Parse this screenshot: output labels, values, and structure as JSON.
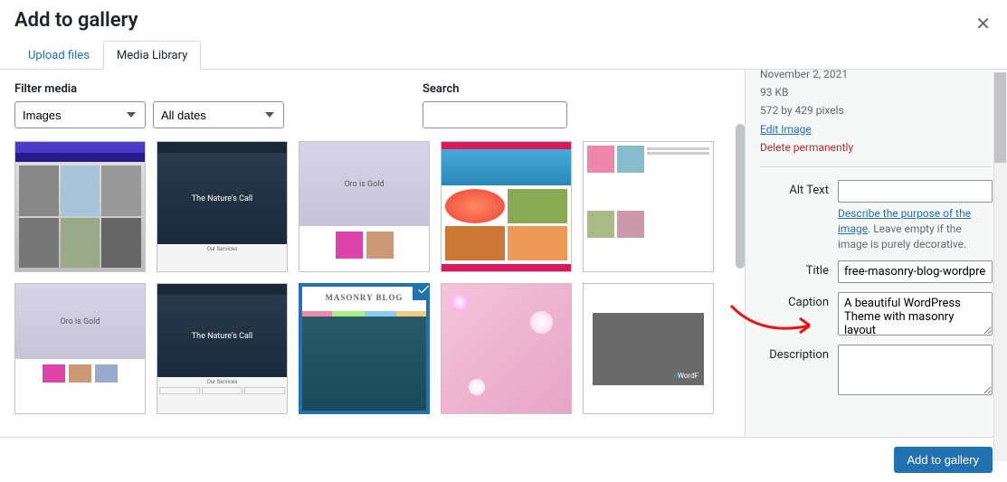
{
  "header": {
    "title": "Add to gallery"
  },
  "tabs": [
    {
      "label": "Upload files",
      "active": false
    },
    {
      "label": "Media Library",
      "active": true
    }
  ],
  "toolbar": {
    "filter_label": "Filter media",
    "type_select": "Images",
    "date_select": "All dates",
    "search_label": "Search",
    "search_value": ""
  },
  "grid": {
    "items": [
      {
        "selected": false,
        "label": "Magazine theme thumbnail"
      },
      {
        "selected": false,
        "label": "Nature's Call dark theme"
      },
      {
        "selected": false,
        "label": "Oro is Gold light theme"
      },
      {
        "selected": false,
        "label": "Food magazine grid theme"
      },
      {
        "selected": false,
        "label": "News list layout theme"
      },
      {
        "selected": false,
        "label": "Oro is Gold variant theme"
      },
      {
        "selected": false,
        "label": "Nature's Call services theme"
      },
      {
        "selected": true,
        "label": "Masonry Blog theme"
      },
      {
        "selected": false,
        "label": "Pink flowers photo"
      },
      {
        "selected": false,
        "label": "eWordPress placeholder"
      }
    ]
  },
  "details": {
    "date": "November 2, 2021",
    "filesize": "93 KB",
    "dimensions": "572 by 429 pixels",
    "edit_link": "Edit Image",
    "delete_link": "Delete permanently",
    "alt_label": "Alt Text",
    "alt_value": "",
    "alt_help_link": "Describe the purpose of the image",
    "alt_help_rest": ". Leave empty if the image is purely decorative.",
    "title_label": "Title",
    "title_value": "free-masonry-blog-wordpress-theme",
    "caption_label": "Caption",
    "caption_value": "A beautiful WordPress Theme with masonry layout",
    "description_label": "Description",
    "description_value": ""
  },
  "footer": {
    "submit_label": "Add to gallery"
  }
}
